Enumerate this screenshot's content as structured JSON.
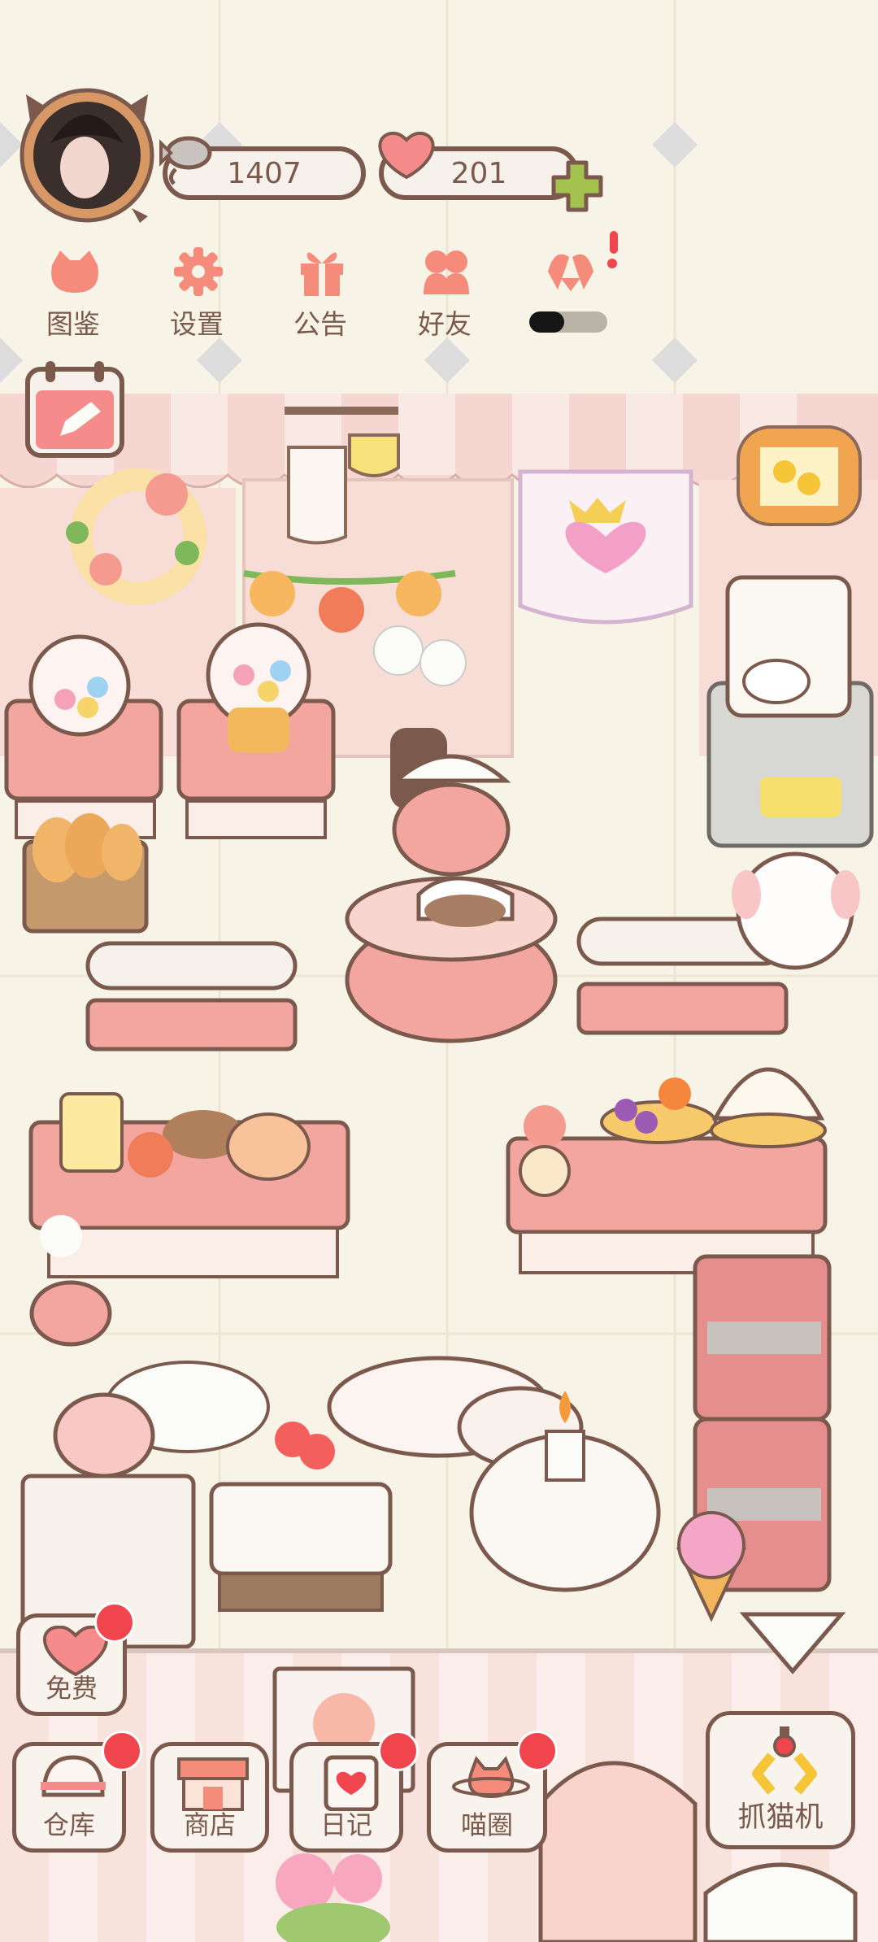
{
  "hud": {
    "coins": "1407",
    "hearts": "201",
    "icons": {
      "coins": "fish-icon",
      "hearts": "heart-icon",
      "add": "plus-icon"
    }
  },
  "menu": [
    {
      "label": "图鉴",
      "icon": "cat-face-icon"
    },
    {
      "label": "设置",
      "icon": "gear-icon"
    },
    {
      "label": "公告",
      "icon": "gift-icon"
    },
    {
      "label": "好友",
      "icon": "friends-icon"
    }
  ],
  "event": {
    "icon": "heart-hands-icon",
    "progress": 0.45
  },
  "actions": {
    "free_label": "免费",
    "warehouse_label": "仓库",
    "shop_label": "商店",
    "diary_label": "日记",
    "circle_label": "喵圈",
    "claw_label": "抓猫机"
  },
  "colors": {
    "brown": "#7b5a4d",
    "pink": "#f3a6a0",
    "cream": "#f7f3e6",
    "badge_red": "#f0454d",
    "green_plus": "#a4c24e"
  }
}
